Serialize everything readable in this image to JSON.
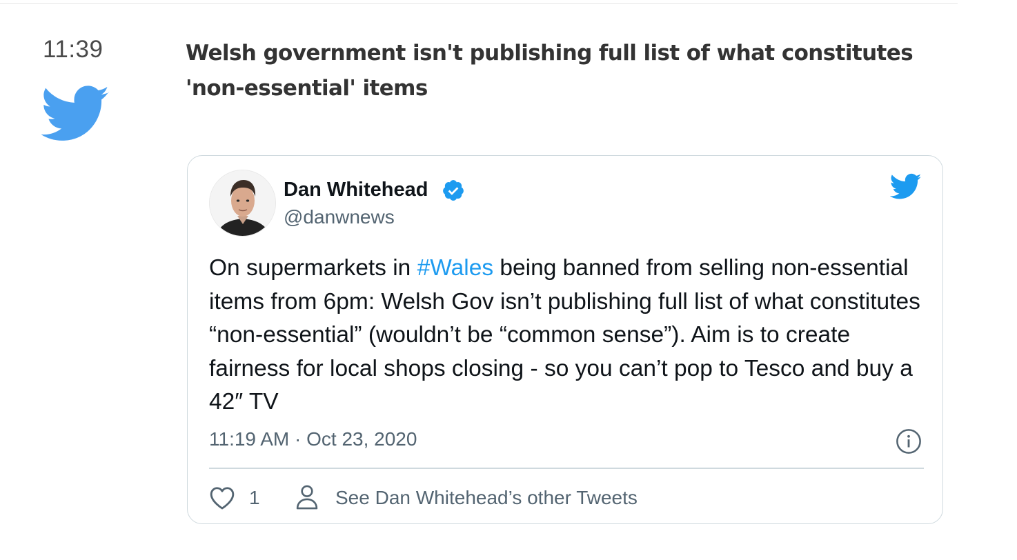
{
  "post": {
    "time": "11:39",
    "headline": "Welsh government isn't publishing full list of what constitutes 'non-essential' items",
    "source_icon": "twitter-bird-icon"
  },
  "embedded_tweet": {
    "author_name": "Dan Whitehead",
    "handle": "@danwnews",
    "verified": true,
    "text_before_hashtag": "On supermarkets in ",
    "hashtag": "#Wales",
    "text_after_hashtag": " being banned from selling non-essential items from 6pm: Welsh Gov isn’t publishing full list of what constitutes “non-essential” (wouldn’t be “common sense”). Aim is to create fairness for local shops closing - so you can’t pop to Tesco and buy a 42″ TV",
    "timestamp": "11:19 AM · Oct 23, 2020",
    "like_count": "1",
    "see_other_tweets_label": "See Dan Whitehead’s other Tweets"
  },
  "colors": {
    "twitter_blue": "#1d9bf0",
    "text_primary": "#0f1419",
    "text_secondary": "#536471",
    "border": "#cfd9de"
  }
}
